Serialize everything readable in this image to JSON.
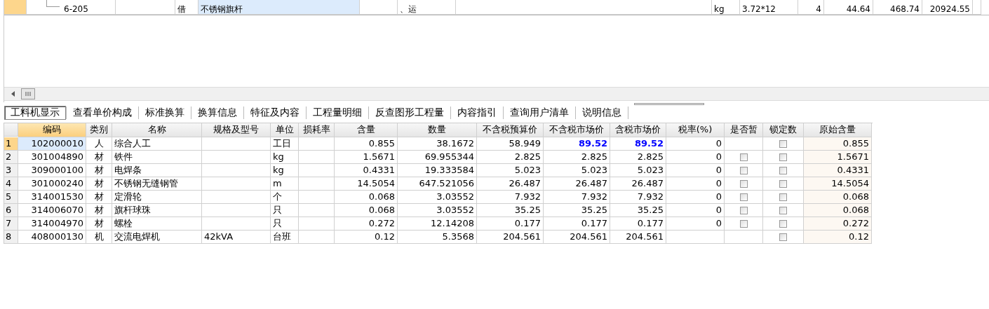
{
  "top_row": {
    "code": "6-205",
    "type": "借",
    "name": "不锈钢旗杆",
    "work_content": "、运",
    "unit": "kg",
    "expression": "3.72*12",
    "quantity_tail": "4",
    "column_11": "44.64",
    "column_12": "468.74",
    "column_13": "20924.55"
  },
  "tabs": [
    {
      "label": "工料机显示",
      "selected": true
    },
    {
      "label": "查看单价构成",
      "selected": false
    },
    {
      "label": "标准换算",
      "selected": false
    },
    {
      "label": "换算信息",
      "selected": false
    },
    {
      "label": "特征及内容",
      "selected": false
    },
    {
      "label": "工程量明细",
      "selected": false
    },
    {
      "label": "反查图形工程量",
      "selected": false
    },
    {
      "label": "内容指引",
      "selected": false
    },
    {
      "label": "查询用户清单",
      "selected": false
    },
    {
      "label": "说明信息",
      "selected": false
    }
  ],
  "table": {
    "columns": [
      "编码",
      "类别",
      "名称",
      "规格及型号",
      "单位",
      "损耗率",
      "含量",
      "数量",
      "不含税预算价",
      "不含税市场价",
      "含税市场价",
      "税率(%)",
      "是否暂",
      "锁定数",
      "原始含量"
    ],
    "rows": [
      {
        "index": "1",
        "selected": true,
        "code": "102000010",
        "category": "人",
        "name": "综合人工",
        "spec": "",
        "unit": "工日",
        "loss": "",
        "content": "0.855",
        "quantity": "38.1672",
        "budget_price": "58.949",
        "market_price": "89.52",
        "market_price_tax": "89.52",
        "price_adjusted": true,
        "tax_rate": "0",
        "locked": false,
        "original_content": "0.855"
      },
      {
        "index": "2",
        "selected": false,
        "code": "301004890",
        "category": "材",
        "name": "铁件",
        "spec": "",
        "unit": "kg",
        "loss": "",
        "content": "1.5671",
        "quantity": "69.955344",
        "budget_price": "2.825",
        "market_price": "2.825",
        "market_price_tax": "2.825",
        "price_adjusted": false,
        "tax_rate": "0",
        "tentative": false,
        "locked": false,
        "original_content": "1.5671"
      },
      {
        "index": "3",
        "selected": false,
        "code": "309000100",
        "category": "材",
        "name": "电焊条",
        "spec": "",
        "unit": "kg",
        "loss": "",
        "content": "0.4331",
        "quantity": "19.333584",
        "budget_price": "5.023",
        "market_price": "5.023",
        "market_price_tax": "5.023",
        "price_adjusted": false,
        "tax_rate": "0",
        "tentative": false,
        "locked": false,
        "original_content": "0.4331"
      },
      {
        "index": "4",
        "selected": false,
        "code": "301000240",
        "category": "材",
        "name": "不锈钢无缝钢管",
        "spec": "",
        "unit": "m",
        "loss": "",
        "content": "14.5054",
        "quantity": "647.521056",
        "budget_price": "26.487",
        "market_price": "26.487",
        "market_price_tax": "26.487",
        "price_adjusted": false,
        "tax_rate": "0",
        "tentative": false,
        "locked": false,
        "original_content": "14.5054"
      },
      {
        "index": "5",
        "selected": false,
        "code": "314001530",
        "category": "材",
        "name": "定滑轮",
        "spec": "",
        "unit": "个",
        "loss": "",
        "content": "0.068",
        "quantity": "3.03552",
        "budget_price": "7.932",
        "market_price": "7.932",
        "market_price_tax": "7.932",
        "price_adjusted": false,
        "tax_rate": "0",
        "tentative": false,
        "locked": false,
        "original_content": "0.068"
      },
      {
        "index": "6",
        "selected": false,
        "code": "314006070",
        "category": "材",
        "name": "旗杆球珠",
        "spec": "",
        "unit": "只",
        "loss": "",
        "content": "0.068",
        "quantity": "3.03552",
        "budget_price": "35.25",
        "market_price": "35.25",
        "market_price_tax": "35.25",
        "price_adjusted": false,
        "tax_rate": "0",
        "tentative": false,
        "locked": false,
        "original_content": "0.068"
      },
      {
        "index": "7",
        "selected": false,
        "code": "314004970",
        "category": "材",
        "name": "螺栓",
        "spec": "",
        "unit": "只",
        "loss": "",
        "content": "0.272",
        "quantity": "12.14208",
        "budget_price": "0.177",
        "market_price": "0.177",
        "market_price_tax": "0.177",
        "price_adjusted": false,
        "tax_rate": "0",
        "tentative": false,
        "locked": false,
        "original_content": "0.272"
      },
      {
        "index": "8",
        "selected": false,
        "code": "408000130",
        "category": "机",
        "name": "交流电焊机",
        "spec": "42kVA",
        "unit": "台班",
        "loss": "",
        "content": "0.12",
        "quantity": "5.3568",
        "budget_price": "204.561",
        "market_price": "204.561",
        "market_price_tax": "204.561",
        "price_adjusted": false,
        "tax_rate": "",
        "locked": false,
        "original_content": "0.12"
      }
    ]
  }
}
